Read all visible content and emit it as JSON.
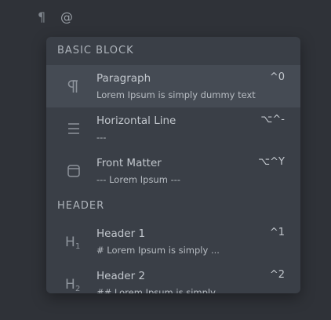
{
  "toolbar": {
    "paragraph_icon": "¶",
    "at_icon": "@"
  },
  "popup": {
    "sections": [
      {
        "title": "BASIC BLOCK"
      },
      {
        "title": "HEADER"
      }
    ],
    "items": [
      {
        "icon": "paragraph-icon",
        "title": "Paragraph",
        "desc": "Lorem Ipsum is simply dummy text",
        "shortcut": "^0"
      },
      {
        "icon": "horizontal-line-icon",
        "title": "Horizontal Line",
        "desc": "---",
        "shortcut": "⌥^-"
      },
      {
        "icon": "front-matter-icon",
        "title": "Front Matter",
        "desc": "--- Lorem Ipsum ---",
        "shortcut": "⌥^Y"
      },
      {
        "icon": "header-1-icon",
        "title": "Header 1",
        "desc": "# Lorem Ipsum is simply ...",
        "shortcut": "^1"
      },
      {
        "icon": "header-2-icon",
        "title": "Header 2",
        "desc": "## Lorem Ipsum is simply ...",
        "shortcut": "^2"
      }
    ]
  }
}
